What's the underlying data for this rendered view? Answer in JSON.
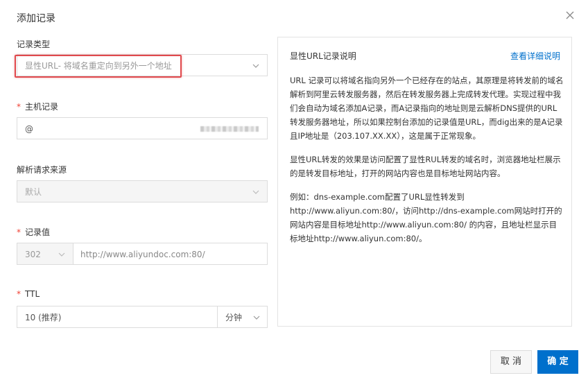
{
  "dialog": {
    "title": "添加记录",
    "close_icon": "close-icon"
  },
  "form": {
    "record_type": {
      "label": "记录类型",
      "value": "显性URL- 将域名重定向到另外一个地址"
    },
    "host_record": {
      "label": "主机记录",
      "required_mark": "*",
      "value": "@"
    },
    "resolution_source": {
      "label": "解析请求来源",
      "value": "默认"
    },
    "record_value": {
      "label": "记录值",
      "required_mark": "*",
      "code": "302",
      "url_placeholder": "http://www.aliyundoc.com:80/"
    },
    "ttl": {
      "label": "TTL",
      "required_mark": "*",
      "value": "10 (推荐)",
      "unit": "分钟"
    }
  },
  "info": {
    "title": "显性URL记录说明",
    "link": "查看详细说明",
    "paragraphs": [
      "URL 记录可以将域名指向另外一个已经存在的站点，其原理是将转发前的域名解析到阿里云转发服务器，然后在转发服务器上完成转发代理。实现过程中我们会自动为域名添加A记录，而A记录指向的地址则是云解析DNS提供的URL转发服务器地址，所以如果控制台添加的记录值是URL，而dig出来的是A记录且IP地址是（203.107.XX.XX），这是属于正常现象。",
      "显性URL转发的效果是访问配置了显性RUL转发的域名时，浏览器地址栏展示的是转发目标地址，打开的网站内容也是目标地址网站内容。",
      "例如：dns-example.com配置了URL显性转发到http://www.aliyun.com:80/，访问http://dns-example.com网站时打开的网站内容是目标地址http://www.aliyun.com:80/ 的内容，且地址栏显示目标地址http://www.aliyun.com:80/。"
    ]
  },
  "footer": {
    "cancel": "取 消",
    "ok": "确 定"
  },
  "colors": {
    "primary": "#0070cc",
    "required": "#f04134",
    "highlight": "#e0494d"
  }
}
